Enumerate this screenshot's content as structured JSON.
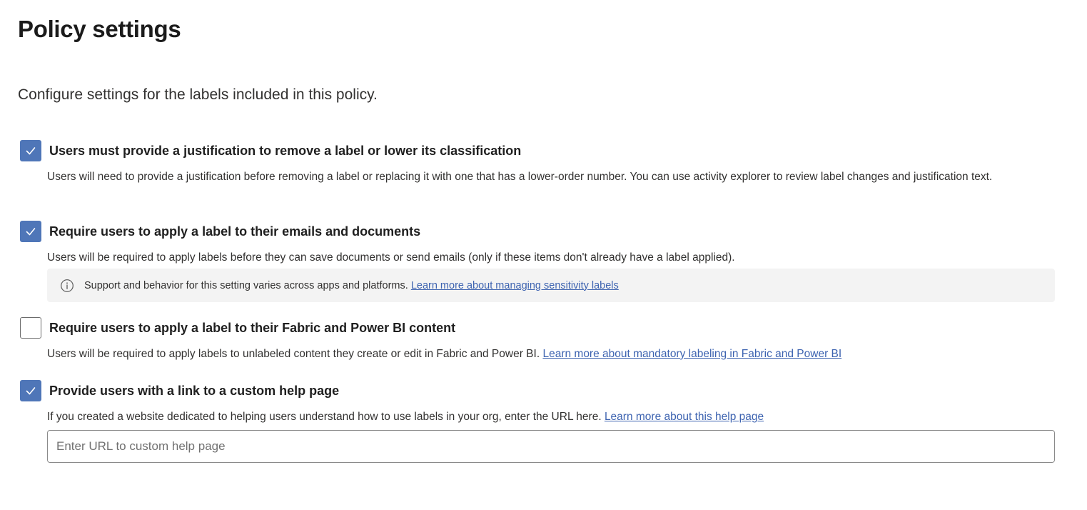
{
  "page": {
    "title": "Policy settings",
    "subtitle": "Configure settings for the labels included in this policy."
  },
  "settings": [
    {
      "label": "Users must provide a justification to remove a label or lower its classification",
      "checked": true,
      "description": "Users will need to provide a justification before removing a label or replacing it with one that has a lower-order number. You can use activity explorer to review label changes and justification text."
    },
    {
      "label": "Require users to apply a label to their emails and documents",
      "checked": true,
      "description": "Users will be required to apply labels before they can save documents or send emails (only if these items don't already have a label applied).",
      "info_text": "Support and behavior for this setting varies across apps and platforms.",
      "info_link": "Learn more about managing sensitivity labels"
    },
    {
      "label": "Require users to apply a label to their Fabric and Power BI content",
      "checked": false,
      "description": "Users will be required to apply labels to unlabeled content they create or edit in Fabric and Power BI.",
      "link": "Learn more about mandatory labeling in Fabric and Power BI"
    },
    {
      "label": "Provide users with a link to a custom help page",
      "checked": true,
      "description": "If you created a website dedicated to helping users understand how to use labels in your org, enter the URL here.",
      "link": "Learn more about this help page"
    }
  ],
  "help_url_input": {
    "placeholder": "Enter URL to custom help page",
    "value": ""
  },
  "colors": {
    "checkbox_checked": "#4f76b8",
    "link": "#3d63b0",
    "info_background": "#f3f3f3"
  },
  "icons": {
    "checkbox": "checkmark-icon",
    "info": "info-circle-icon"
  }
}
